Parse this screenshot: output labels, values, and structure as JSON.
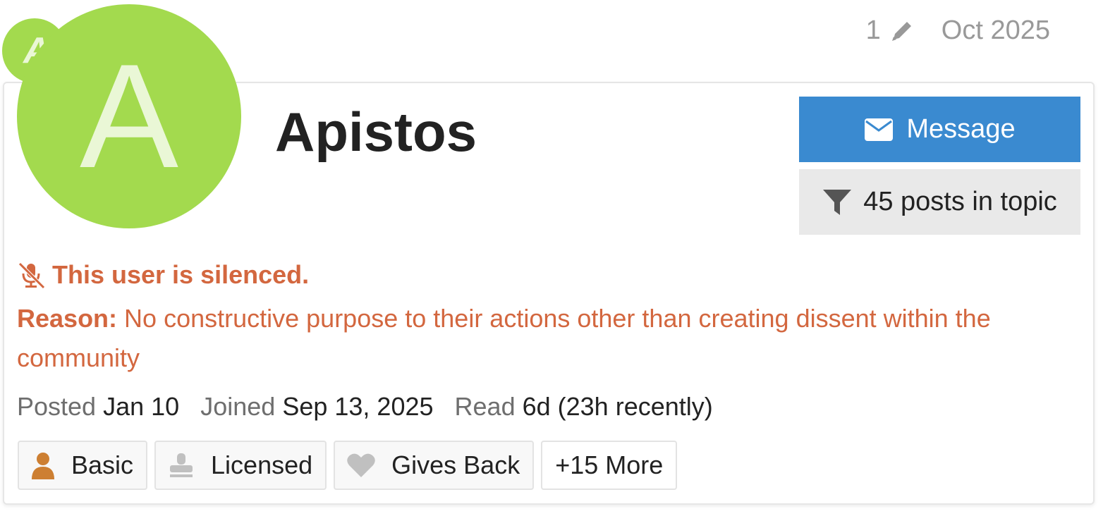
{
  "post_meta": {
    "edit_count": "1",
    "edit_icon": "pencil-icon",
    "date": "Oct 2025"
  },
  "user": {
    "avatar_letter": "A",
    "avatar_color": "#a3da4e",
    "name": "Apistos"
  },
  "actions": {
    "message_label": "Message",
    "message_icon": "envelope-icon",
    "message_color": "#3a8ad0",
    "filter_label": "45 posts in topic",
    "filter_icon": "funnel-icon"
  },
  "silence": {
    "title": "This user is silenced.",
    "reason_label": "Reason:",
    "reason_text": "No constructive purpose to their actions other than creating dissent within the community",
    "color": "#d3673f",
    "icon": "microphone-slash-icon"
  },
  "stats": {
    "posted_label": "Posted",
    "posted_value": "Jan 10",
    "joined_label": "Joined",
    "joined_value": "Sep 13, 2025",
    "read_label": "Read",
    "read_value": "6d (23h recently)"
  },
  "badges": [
    {
      "label": "Basic",
      "icon": "user-icon",
      "color": "#cd7f32"
    },
    {
      "label": "Licensed",
      "icon": "stamp-icon",
      "color": "#c0c0c0"
    },
    {
      "label": "Gives Back",
      "icon": "heart-icon",
      "color": "#c0c0c0"
    }
  ],
  "more_badges_label": "+15 More"
}
